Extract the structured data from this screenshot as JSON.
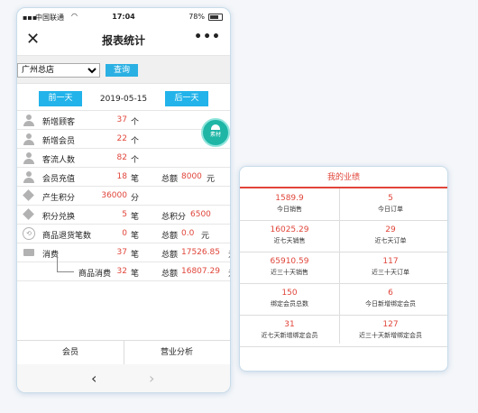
{
  "status": {
    "carrier": "中国联通",
    "time": "17:04",
    "battery": "78%"
  },
  "nav": {
    "title": "报表统计",
    "close": "✕",
    "more": "•••"
  },
  "store": {
    "selected": "广州总店",
    "query": "查询"
  },
  "date_bar": {
    "prev": "前一天",
    "date": "2019-05-15",
    "next": "后一天"
  },
  "float_button": {
    "label": "素材"
  },
  "rows": [
    {
      "icon": "person",
      "label": "新增顾客",
      "value": "37",
      "unit": "个"
    },
    {
      "icon": "person",
      "label": "新增会员",
      "value": "22",
      "unit": "个"
    },
    {
      "icon": "person",
      "label": "客流人数",
      "value": "82",
      "unit": "个"
    },
    {
      "icon": "person",
      "label": "会员充值",
      "value": "18",
      "unit": "笔",
      "label2": "总额",
      "value2": "8000",
      "unit2": "元"
    },
    {
      "icon": "tag",
      "label": "产生积分",
      "value": "36000",
      "unit": "分"
    },
    {
      "icon": "tag",
      "label": "积分兑换",
      "value": "5",
      "unit": "笔",
      "label2": "总积分",
      "value2": "6500"
    },
    {
      "icon": "cart",
      "label": "商品退货笔数",
      "value": "0",
      "unit": "笔",
      "label2": "总额",
      "value2": "0.0",
      "unit2": "元"
    },
    {
      "icon": "card",
      "label": "消费",
      "value": "37",
      "unit": "笔",
      "label2": "总额",
      "value2": "17526.85",
      "unit2": "元"
    },
    {
      "icon": "",
      "label": "商品消费",
      "value": "32",
      "unit": "笔",
      "label2": "总额",
      "value2": "16807.29",
      "unit2": "元",
      "sub": true
    }
  ],
  "tabs": [
    "会员",
    "营业分析"
  ],
  "browser": {
    "back": "‹",
    "forward": "›"
  },
  "performance": {
    "title": "我的业绩",
    "cells": [
      {
        "value": "1589.9",
        "label": "今日销售"
      },
      {
        "value": "5",
        "label": "今日订单"
      },
      {
        "value": "16025.29",
        "label": "近七天销售"
      },
      {
        "value": "29",
        "label": "近七天订单"
      },
      {
        "value": "65910.59",
        "label": "近三十天销售"
      },
      {
        "value": "117",
        "label": "近三十天订单"
      },
      {
        "value": "150",
        "label": "绑定会员总数"
      },
      {
        "value": "6",
        "label": "今日新增绑定会员"
      },
      {
        "value": "31",
        "label": "近七天新增绑定会员"
      },
      {
        "value": "127",
        "label": "近三十天新增绑定会员"
      }
    ]
  }
}
